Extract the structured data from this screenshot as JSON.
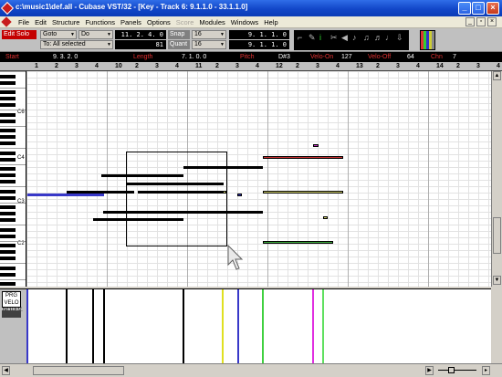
{
  "window": {
    "title": "c:\\music1\\def.all - Cubase VST/32 - [Key - Track 6:  9.1.1.0 - 33.1.1.0]",
    "min_btn": "_",
    "max_btn": "□",
    "close_btn": "×"
  },
  "menu": {
    "items": [
      "File",
      "Edit",
      "Structure",
      "Functions",
      "Panels",
      "Options",
      "Score",
      "Modules",
      "Windows",
      "Help"
    ],
    "disabled": "Score",
    "mdi_min": "_",
    "mdi_restore": "▫",
    "mdi_close": "×"
  },
  "toolbar": {
    "edit_solo": "Edit Solo",
    "goto": "Goto",
    "do": "Do",
    "to_selection": "To: All selected",
    "position": "11. 2. 4.    0",
    "value": "81",
    "snap_label": "Snap",
    "snap_value": "16",
    "quant_label": "Quant",
    "quant_value": "16",
    "left_locator": "9.  1.  1.    0",
    "right_locator": "9.  1.  1.    0"
  },
  "info": {
    "start_label": "Start",
    "start_value": "9.  3.  2.    0",
    "length_label": "Length",
    "length_value": "7.  1.  0.    0",
    "pitch_label": "Pitch",
    "pitch_value": "D#3",
    "velo_on_label": "Velo-On",
    "velo_on_value": "127",
    "velo_off_label": "Velo-Off",
    "velo_off_value": "64",
    "chn_label": "Chn",
    "chn_value": "7"
  },
  "ruler": {
    "ticks": [
      "1",
      "2",
      "3",
      "4",
      "10",
      "2",
      "3",
      "4",
      "11",
      "2",
      "3",
      "4",
      "12",
      "2",
      "3",
      "4",
      "13",
      "2",
      "3",
      "4",
      "14",
      "2",
      "3",
      "4"
    ]
  },
  "keyboard": {
    "labels": [
      "C6",
      "C4",
      "C3",
      "C2"
    ]
  },
  "controller": {
    "panel_label": "PRG VELO NOTEV."
  },
  "colors": {
    "note_default": "#000000",
    "note_blue": "#3838c8",
    "note_red": "#c83030",
    "note_yellow": "#d8d870",
    "note_green": "#40b040",
    "note_magenta": "#c030c0"
  }
}
